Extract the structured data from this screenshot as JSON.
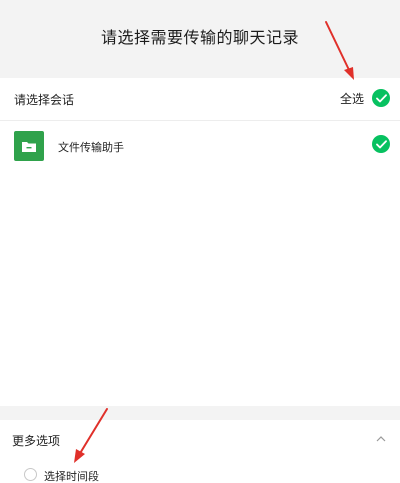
{
  "header": {
    "title": "请选择需要传输的聊天记录"
  },
  "session_section": {
    "label": "请选择会话",
    "select_all_label": "全选",
    "select_all_checked": true
  },
  "chats": [
    {
      "name": "文件传输助手",
      "checked": true,
      "avatar_icon": "folder-icon"
    }
  ],
  "more_options": {
    "label": "更多选项",
    "expanded": true,
    "options": [
      {
        "label": "选择时间段",
        "selected": false
      }
    ]
  },
  "colors": {
    "accent_green": "#07c160",
    "avatar_green": "#2fa24b",
    "annotation_red": "#e0302a",
    "header_bg": "#f3f3f3"
  }
}
